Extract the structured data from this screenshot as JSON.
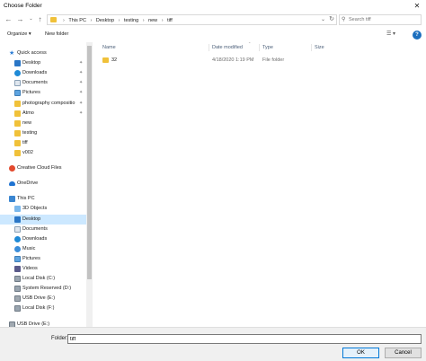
{
  "window": {
    "title": "Choose Folder",
    "close_glyph": "✕"
  },
  "address": {
    "crumbs": [
      "This PC",
      "Desktop",
      "testing",
      "new",
      "tiff"
    ],
    "separator": "›",
    "search_placeholder": "Search tiff"
  },
  "toolbar": {
    "organize_label": "Organize ▾",
    "new_folder_label": "New folder"
  },
  "nav": {
    "items": [
      {
        "label": "Quick access",
        "icon": "star-icon",
        "indent": 0,
        "pinned": false,
        "selected": false
      },
      {
        "label": "Desktop",
        "icon": "desktop-icon",
        "indent": 1,
        "pinned": true,
        "selected": false
      },
      {
        "label": "Downloads",
        "icon": "downloads-icon",
        "indent": 1,
        "pinned": true,
        "selected": false
      },
      {
        "label": "Documents",
        "icon": "documents-icon",
        "indent": 1,
        "pinned": true,
        "selected": false
      },
      {
        "label": "Pictures",
        "icon": "pictures-icon",
        "indent": 1,
        "pinned": true,
        "selected": false
      },
      {
        "label": "photography compositio",
        "icon": "folder-icon",
        "indent": 1,
        "pinned": true,
        "selected": false
      },
      {
        "label": "Atmo",
        "icon": "folder-icon",
        "indent": 1,
        "pinned": true,
        "selected": false
      },
      {
        "label": "new",
        "icon": "folder-icon",
        "indent": 1,
        "pinned": false,
        "selected": false
      },
      {
        "label": "testing",
        "icon": "folder-icon",
        "indent": 1,
        "pinned": false,
        "selected": false
      },
      {
        "label": "tiff",
        "icon": "folder-icon",
        "indent": 1,
        "pinned": false,
        "selected": false
      },
      {
        "label": "v002",
        "icon": "folder-icon",
        "indent": 1,
        "pinned": false,
        "selected": false
      },
      {
        "label": "Creative Cloud Files",
        "icon": "creative-cloud-icon",
        "indent": 0,
        "pinned": false,
        "selected": false
      },
      {
        "label": "OneDrive",
        "icon": "onedrive-icon",
        "indent": 0,
        "pinned": false,
        "selected": false
      },
      {
        "label": "This PC",
        "icon": "this-pc-icon",
        "indent": 0,
        "pinned": false,
        "selected": false
      },
      {
        "label": "3D Objects",
        "icon": "3d-objects-icon",
        "indent": 1,
        "pinned": false,
        "selected": false
      },
      {
        "label": "Desktop",
        "icon": "desktop-icon",
        "indent": 1,
        "pinned": false,
        "selected": true
      },
      {
        "label": "Documents",
        "icon": "documents-icon",
        "indent": 1,
        "pinned": false,
        "selected": false
      },
      {
        "label": "Downloads",
        "icon": "downloads-icon",
        "indent": 1,
        "pinned": false,
        "selected": false
      },
      {
        "label": "Music",
        "icon": "music-icon",
        "indent": 1,
        "pinned": false,
        "selected": false
      },
      {
        "label": "Pictures",
        "icon": "pictures-icon",
        "indent": 1,
        "pinned": false,
        "selected": false
      },
      {
        "label": "Videos",
        "icon": "videos-icon",
        "indent": 1,
        "pinned": false,
        "selected": false
      },
      {
        "label": "Local Disk (C:)",
        "icon": "drive-icon",
        "indent": 1,
        "pinned": false,
        "selected": false
      },
      {
        "label": "System Reserved (D:)",
        "icon": "drive-icon",
        "indent": 1,
        "pinned": false,
        "selected": false
      },
      {
        "label": "USB Drive (E:)",
        "icon": "usb-drive-icon",
        "indent": 1,
        "pinned": false,
        "selected": false
      },
      {
        "label": "Local Disk (F:)",
        "icon": "drive-icon",
        "indent": 1,
        "pinned": false,
        "selected": false
      },
      {
        "label": "USB Drive (E:)",
        "icon": "usb-drive-icon",
        "indent": 0,
        "pinned": false,
        "selected": false
      }
    ]
  },
  "list": {
    "columns": {
      "name": "Name",
      "date": "Date modified",
      "type": "Type",
      "size": "Size"
    },
    "rows": [
      {
        "name": "32",
        "date": "4/18/2020 1:19 PM",
        "type": "File folder",
        "size": ""
      }
    ]
  },
  "footer": {
    "folder_label": "Folder:",
    "folder_value": "tiff",
    "ok_label": "OK",
    "cancel_label": "Cancel"
  },
  "colors": {
    "accent": "#0078d7",
    "selection": "#cce8ff",
    "folder": "#f0c13a"
  }
}
